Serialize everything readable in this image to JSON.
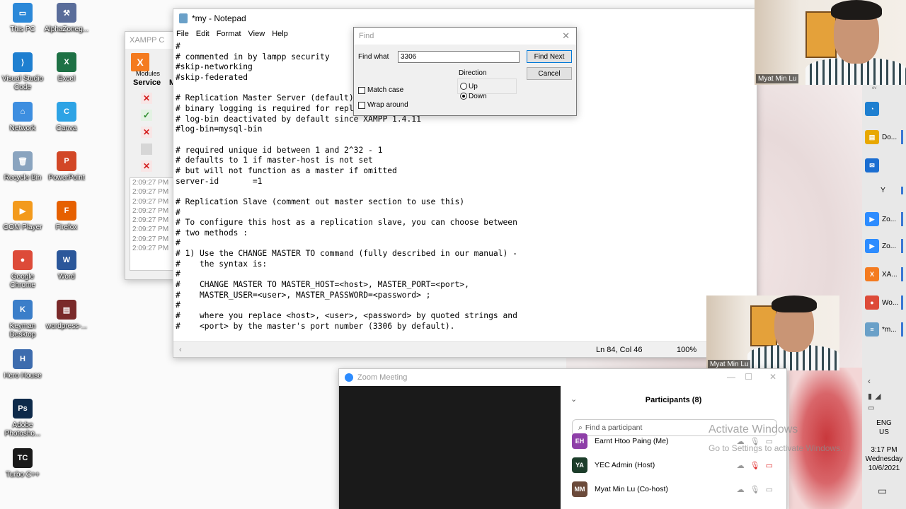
{
  "desktop": {
    "icons": [
      {
        "label": "This PC",
        "color": "#2b88d8",
        "glyph": "▭"
      },
      {
        "label": "AlphaZoneg...",
        "color": "#5a6d9a",
        "glyph": "⚒"
      },
      {
        "label": "Visual Studio Code",
        "color": "#1e7fd0",
        "glyph": "⟩"
      },
      {
        "label": "Excel",
        "color": "#1e7145",
        "glyph": "X"
      },
      {
        "label": "Network",
        "color": "#3d8ee0",
        "glyph": "⌂"
      },
      {
        "label": "Canva",
        "color": "#2da3e5",
        "glyph": "C"
      },
      {
        "label": "Recycle Bin",
        "color": "#8aa4bf",
        "glyph": "🗑"
      },
      {
        "label": "PowerPoint",
        "color": "#d24726",
        "glyph": "P"
      },
      {
        "label": "GOM Player",
        "color": "#f39a1c",
        "glyph": "▶"
      },
      {
        "label": "Firefox",
        "color": "#e66000",
        "glyph": "F"
      },
      {
        "label": "Google Chrome",
        "color": "#dd4b39",
        "glyph": "●"
      },
      {
        "label": "Word",
        "color": "#2b579a",
        "glyph": "W"
      },
      {
        "label": "Keyman Desktop",
        "color": "#3b7ec9",
        "glyph": "K"
      },
      {
        "label": "wordpress-...",
        "color": "#7a2a2a",
        "glyph": "▤"
      },
      {
        "label": "Hero House",
        "color": "#3d6cae",
        "glyph": "H"
      },
      {
        "label": "Adobe Photosho...",
        "color": "#0e2a4a",
        "glyph": "Ps"
      },
      {
        "label": "Turbo C++",
        "color": "#1a1a1a",
        "glyph": "TC"
      }
    ]
  },
  "xampp": {
    "title": "XAMPP C",
    "logo": "X",
    "modules_label": "Modules",
    "service_header": "Service",
    "col_header_m": "M",
    "service_states": [
      {
        "symbol": "✕",
        "color": "#d42020",
        "bg": "#f8e6e6"
      },
      {
        "symbol": "✓",
        "color": "#2a8a2a",
        "bg": "#e3f2e3"
      },
      {
        "symbol": "✕",
        "color": "#d42020",
        "bg": "#f8e6e6"
      },
      {
        "symbol": "",
        "color": "#999",
        "bg": "#d6d6d6"
      },
      {
        "symbol": "✕",
        "color": "#d42020",
        "bg": "#f8e6e6"
      }
    ],
    "log": [
      "2:09:27 PM",
      "2:09:27 PM",
      "2:09:27 PM",
      "2:09:27 PM",
      "2:09:27 PM",
      "2:09:27 PM",
      "2:09:27 PM",
      "2:09:27 PM"
    ]
  },
  "notepad": {
    "title": "*my - Notepad",
    "menu": [
      "File",
      "Edit",
      "Format",
      "View",
      "Help"
    ],
    "lines": [
      "#",
      "# commented in by lampp security",
      "#skip-networking",
      "#skip-federated",
      "",
      "# Replication Master Server (default)",
      "# binary logging is required for repli",
      "# log-bin deactivated by default since XAMPP 1.4.11",
      "#log-bin=mysql-bin",
      "",
      "# required unique id between 1 and 2^32 - 1",
      "# defaults to 1 if master-host is not set",
      "# but will not function as a master if omitted",
      "server-id       =1",
      "",
      "# Replication Slave (comment out master section to use this)",
      "#",
      "# To configure this host as a replication slave, you can choose between",
      "# two methods :",
      "#",
      "# 1) Use the CHANGE MASTER TO command (fully described in our manual) -",
      "#    the syntax is:",
      "#",
      "#    CHANGE MASTER TO MASTER_HOST=<host>, MASTER_PORT=<port>,",
      "#    MASTER_USER=<user>, MASTER_PASSWORD=<password> ;",
      "#",
      "#    where you replace <host>, <user>, <password> by quoted strings and",
      "#    <port> by the master's port number (3306 by default)."
    ],
    "status": {
      "position": "Ln 84, Col 46",
      "zoom": "100%"
    }
  },
  "find": {
    "title": "Find",
    "find_what_label": "Find what",
    "find_what_value": "3306",
    "find_next": "Find Next",
    "cancel": "Cancel",
    "direction_label": "Direction",
    "up": "Up",
    "down": "Down",
    "match_case": "Match case",
    "wrap_around": "Wrap around"
  },
  "cams": {
    "top_name": "Myat Min Lu",
    "small_name": "Myat Min Lu"
  },
  "zoom": {
    "title": "Zoom Meeting",
    "participants_title": "Participants (8)",
    "search_placeholder": "Find a participant",
    "participants": [
      {
        "initials": "EH",
        "name": "Earnt Htoo Paing (Me)",
        "color": "#8e3fa8"
      },
      {
        "initials": "YA",
        "name": "YEC Admin (Host)",
        "color": "#1c3d2a"
      },
      {
        "initials": "MM",
        "name": "Myat Min Lu (Co-host)",
        "color": "#6b4a3a"
      }
    ]
  },
  "taskbar": {
    "items": [
      {
        "label": "",
        "color": "#1e7fd0",
        "glyph": "◔"
      },
      {
        "label": "Do...",
        "color": "#e8a800",
        "glyph": "▤"
      },
      {
        "label": "",
        "color": "#1b6ed1",
        "glyph": "✉"
      },
      {
        "label": "Y",
        "color": "",
        "glyph": ""
      },
      {
        "label": "Zo...",
        "color": "#2d8cff",
        "glyph": "▶"
      },
      {
        "label": "Zo...",
        "color": "#2d8cff",
        "glyph": "▶"
      },
      {
        "label": "XA...",
        "color": "#f47b20",
        "glyph": "X"
      },
      {
        "label": "Wo...",
        "color": "#dd4b39",
        "glyph": "●"
      },
      {
        "label": "*m...",
        "color": "#6aa0c8",
        "glyph": "≡"
      }
    ],
    "lang": "ENG",
    "region": "US",
    "time": "3:17 PM",
    "day": "Wednesday",
    "date": "10/6/2021"
  },
  "watermark": {
    "line1": "Activate Windows",
    "line2": "Go to Settings to activate Windows."
  }
}
